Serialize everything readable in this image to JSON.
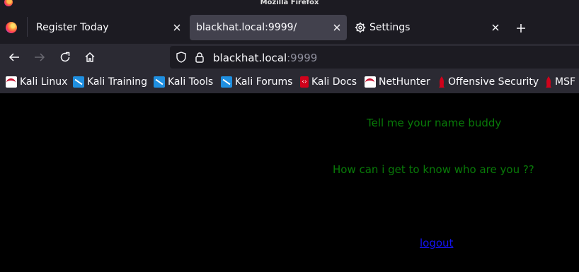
{
  "window": {
    "title": "Mozilla Firefox"
  },
  "tabs": [
    {
      "label": "Register Today",
      "active": false
    },
    {
      "label": "blackhat.local:9999/",
      "active": true
    },
    {
      "label": "Settings",
      "active": false,
      "icon": "gear-icon"
    }
  ],
  "navbar": {
    "url_host": "blackhat.local",
    "url_port": ":9999"
  },
  "bookmarks": [
    {
      "label": "Kali Linux",
      "icon": "kali-red-icon"
    },
    {
      "label": "Kali Training",
      "icon": "kali-icon"
    },
    {
      "label": "Kali Tools",
      "icon": "kali-icon"
    },
    {
      "label": "Kali Forums",
      "icon": "kali-icon"
    },
    {
      "label": "Kali Docs",
      "icon": "docs-icon"
    },
    {
      "label": "NetHunter",
      "icon": "kali-red-icon"
    },
    {
      "label": "Offensive Security",
      "icon": "offsec-icon"
    },
    {
      "label": "MSF",
      "icon": "offsec-icon"
    }
  ],
  "page": {
    "prompt": "Tell me your name buddy",
    "question": "How can i get to know who are you ??",
    "logout_label": "logout"
  },
  "colors": {
    "text_green": "#087a08",
    "link_blue": "#1414f5",
    "page_bg": "#000000"
  }
}
